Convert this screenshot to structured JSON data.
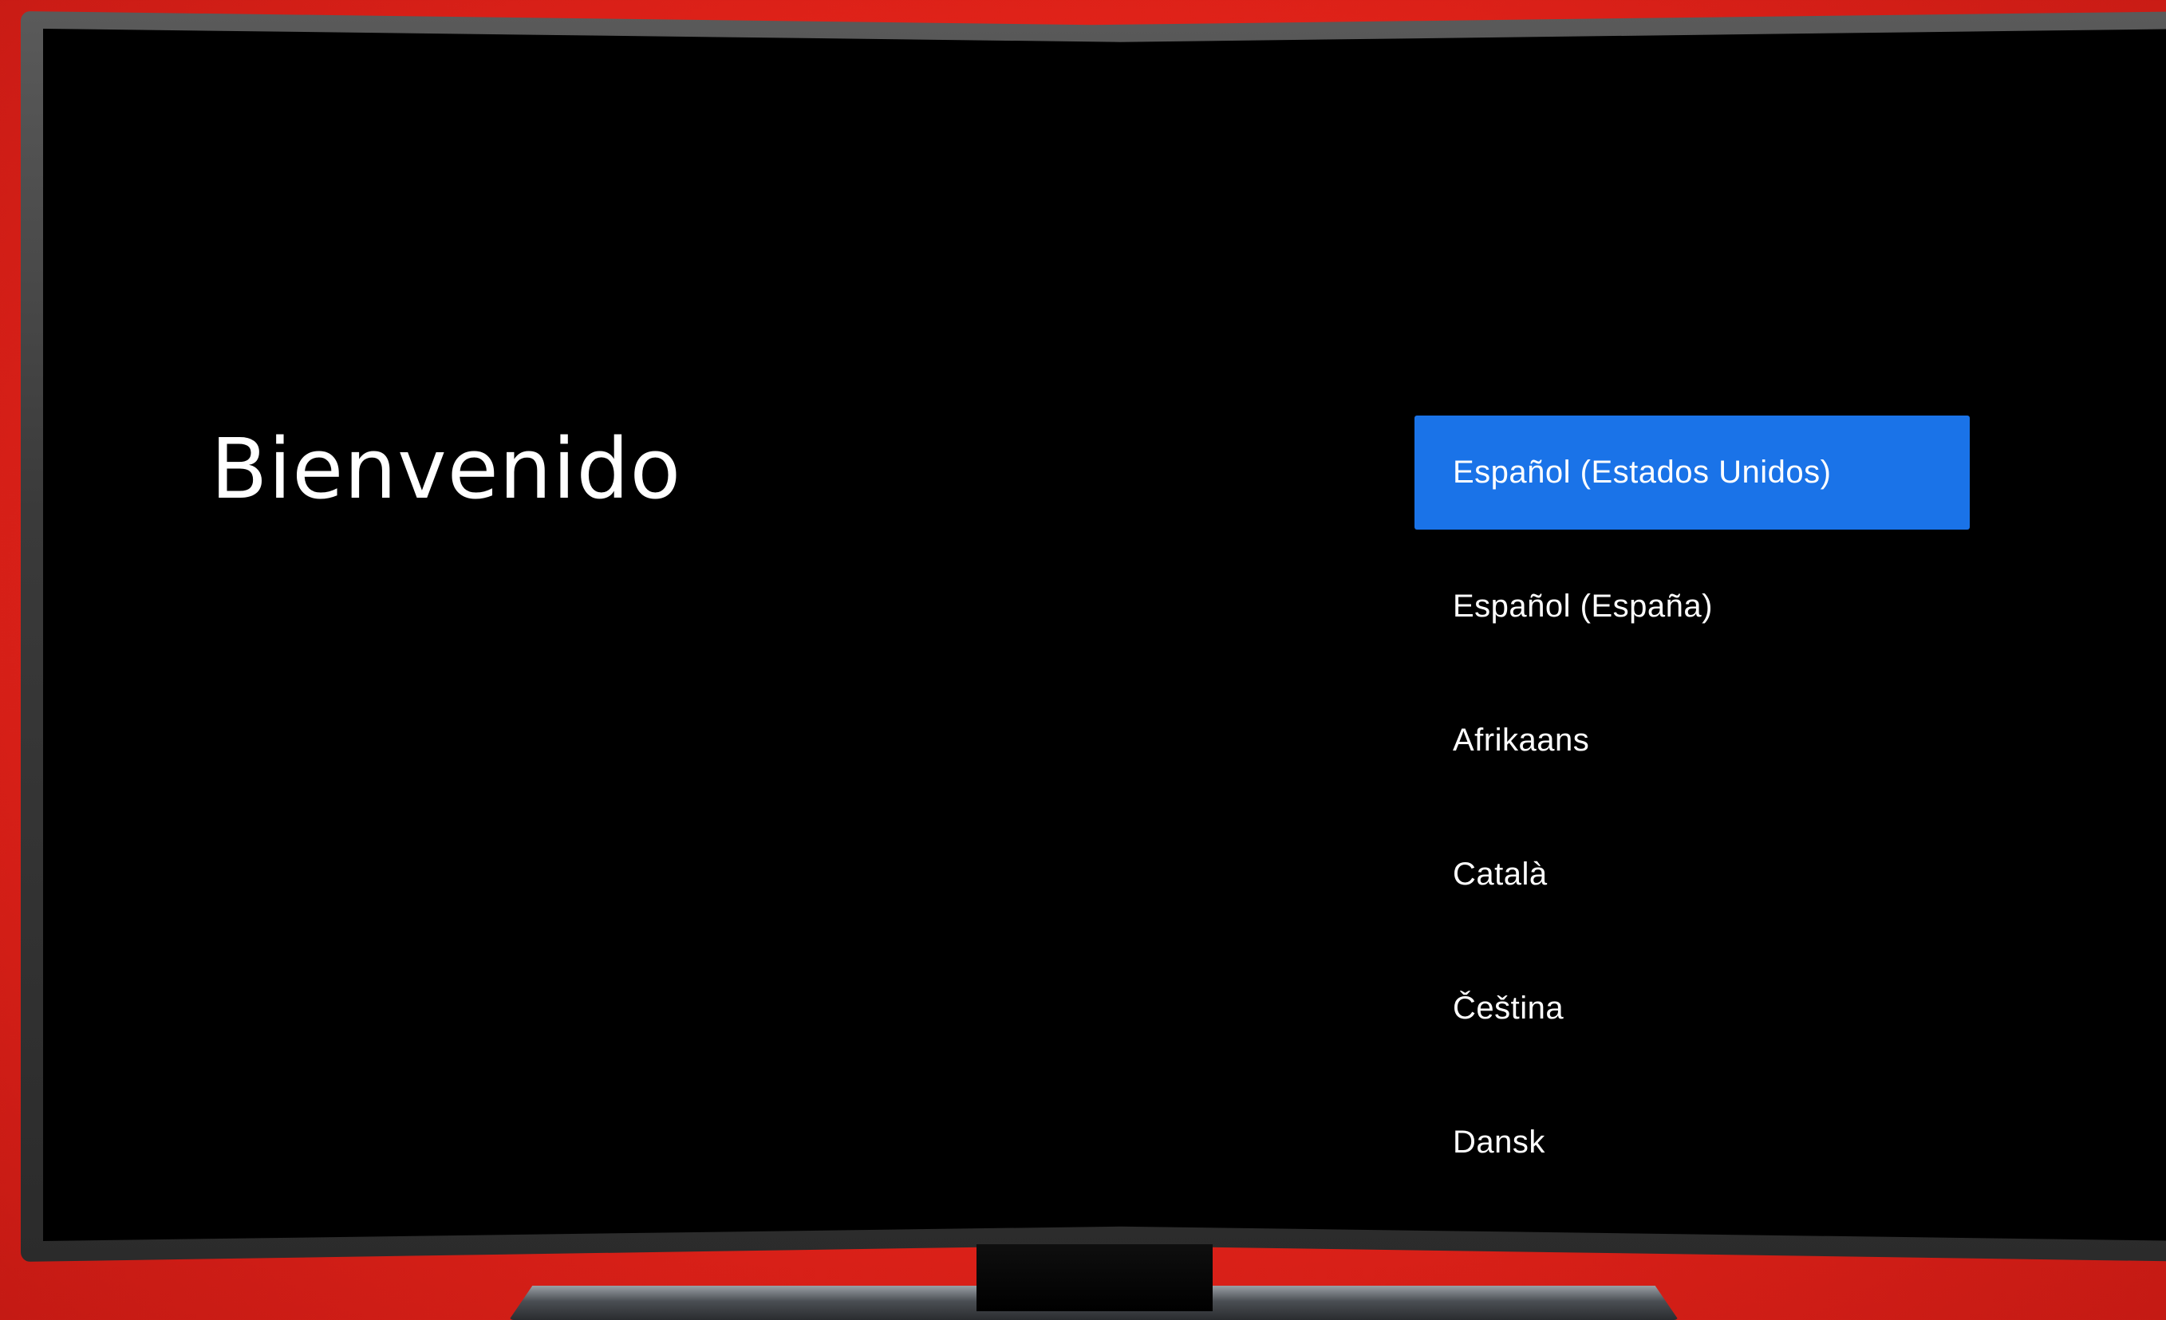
{
  "screen": {
    "title": "Bienvenido"
  },
  "languages": {
    "items": [
      {
        "label": "Español (Estados Unidos)",
        "selected": true
      },
      {
        "label": "Español (España)",
        "selected": false
      },
      {
        "label": "Afrikaans",
        "selected": false
      },
      {
        "label": "Català",
        "selected": false
      },
      {
        "label": "Čeština",
        "selected": false
      },
      {
        "label": "Dansk",
        "selected": false
      }
    ]
  },
  "colors": {
    "background": "#e02219",
    "screen": "#000000",
    "selected_item": "#1a73e8",
    "text": "#ffffff"
  }
}
